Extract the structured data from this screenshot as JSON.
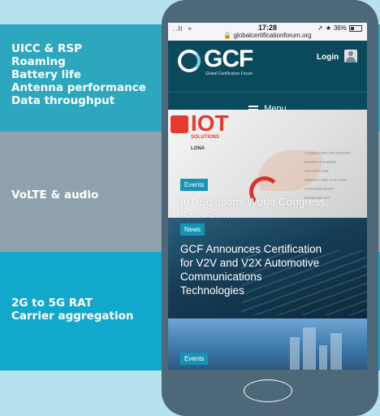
{
  "left_panel": {
    "bands": [
      {
        "text": "UICC & RSP\nRoaming\nBattery life\nAntenna performance\nData throughput",
        "color": "#2ca7bd"
      },
      {
        "text": "VoLTE & audio",
        "color": "#8ea1ac"
      },
      {
        "text": "2G to 5G RAT\nCarrier aggregation",
        "color": "#12a8cc"
      }
    ]
  },
  "status_bar": {
    "signal": "..ll",
    "wifi_icon": "wifi-icon",
    "time": "17:28",
    "url": "globalcertificationforum.org",
    "location_icon": "location-arrow-icon",
    "bluetooth_icon": "bluetooth-icon",
    "battery_percent": "36%",
    "battery_level": 0.36
  },
  "header": {
    "logo_text": "GCF",
    "logo_tagline": "Global Certification Forum",
    "login_label": "Login",
    "menu_label": "Menu"
  },
  "cards": [
    {
      "tag": "Events",
      "title": "IoT Solutions World Congress,\nBarcelona",
      "image_text": {
        "brand": "IOT",
        "brand_sub": "SOLUTIONS",
        "city": "LONA",
        "topics": [
          "CONNECTED TRANSPORT",
          "MANUFACTURING",
          "HEALTHCARE",
          "ENERGY AND UTILITIES",
          "OPEN INDUSTRY",
          "ENABLING IOT"
        ]
      }
    },
    {
      "tag": "News",
      "title": "GCF Announces Certification\nfor V2V and V2X Automotive\nCommunications\nTechnologies"
    },
    {
      "tag": "Events",
      "title": ""
    }
  ],
  "colors": {
    "page_bg": "#b6e2ee",
    "phone_body": "#4d6979",
    "header_bg": "#0b4a5c",
    "tag_bg": "#1595b6",
    "iot_red": "#e73a2e"
  }
}
